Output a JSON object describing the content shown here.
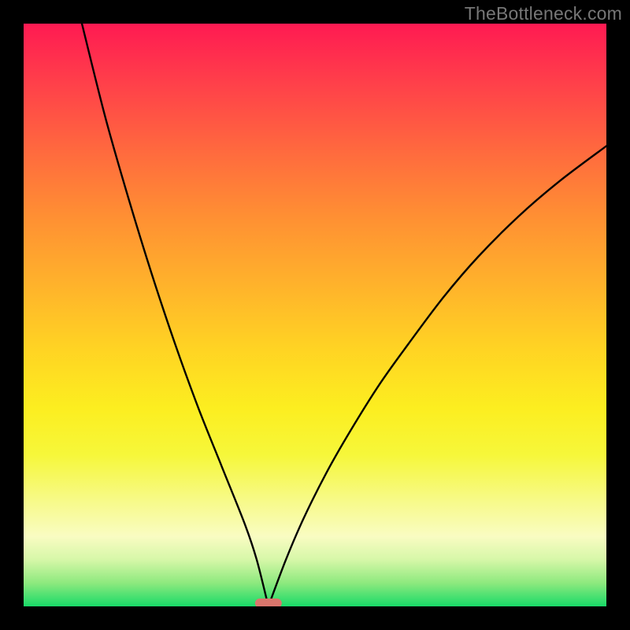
{
  "watermark": "TheBottleneck.com",
  "chart_data": {
    "type": "line",
    "title": "",
    "xlabel": "",
    "ylabel": "",
    "xlim": [
      0,
      100
    ],
    "ylim": [
      0,
      100
    ],
    "background_gradient_meaning": "red=high bottleneck, green=low bottleneck",
    "optimal_marker": {
      "x": 42,
      "y": 0,
      "color": "#d9756c"
    },
    "series": [
      {
        "name": "left-branch",
        "x": [
          10,
          14,
          18,
          22,
          26,
          30,
          34,
          38,
          40,
          42
        ],
        "y": [
          100,
          84,
          70,
          57,
          45,
          34,
          24,
          14,
          8,
          0
        ]
      },
      {
        "name": "right-branch",
        "x": [
          42,
          45,
          48,
          52,
          56,
          61,
          66,
          72,
          78,
          85,
          92,
          100
        ],
        "y": [
          0,
          8,
          15,
          23,
          30,
          38,
          45,
          53,
          60,
          67,
          73,
          79
        ]
      }
    ]
  }
}
